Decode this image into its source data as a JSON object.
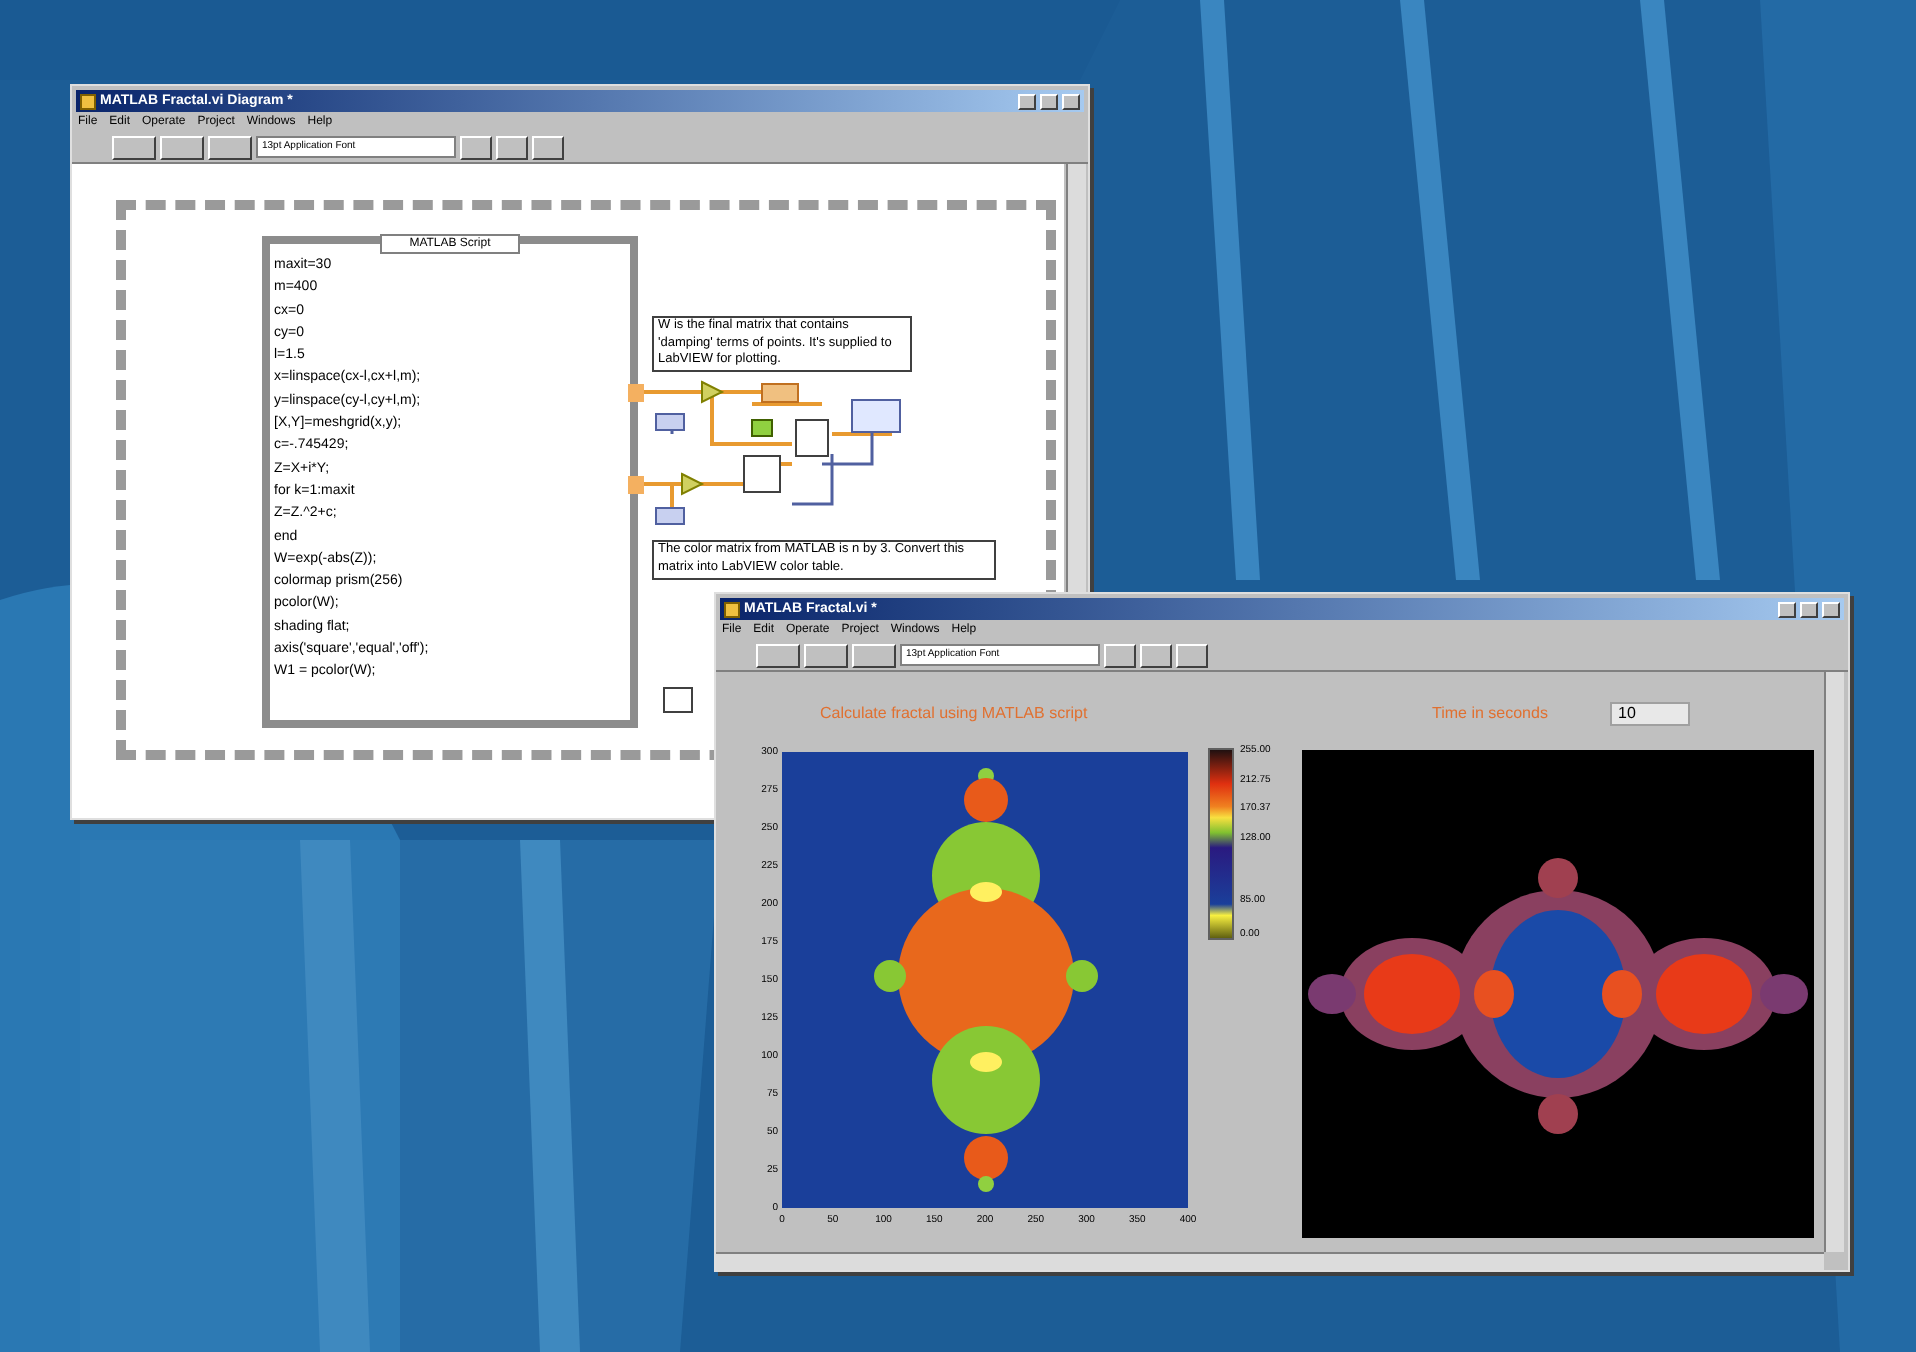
{
  "diagram_window": {
    "title": "MATLAB Fractal.vi Diagram *",
    "menu": [
      "File",
      "Edit",
      "Operate",
      "Project",
      "Windows",
      "Help"
    ],
    "font_selector": "13pt Application Font",
    "script_node": {
      "title": "MATLAB Script",
      "lines": [
        "maxit=30",
        "m=400",
        "cx=0",
        "cy=0",
        "l=1.5",
        "x=linspace(cx-l,cx+l,m);",
        "y=linspace(cy-l,cy+l,m);",
        "[X,Y]=meshgrid(x,y);",
        "c=-.745429;",
        "Z=X+i*Y;",
        "for k=1:maxit",
        "Z=Z.^2+c;",
        "end",
        "W=exp(-abs(Z));",
        "colormap prism(256)",
        "pcolor(W);",
        "shading flat;",
        "axis('square','equal','off');",
        "W1 = pcolor(W);"
      ]
    },
    "comments": [
      "W is the final matrix that contains 'damping' terms of points. It's supplied to LabVIEW for plotting.",
      "The color matrix from MATLAB is n by 3. Convert this matrix into LabVIEW color table."
    ]
  },
  "panel_window": {
    "title": "MATLAB Fractal.vi *",
    "menu": [
      "File",
      "Edit",
      "Operate",
      "Project",
      "Windows",
      "Help"
    ],
    "font_selector": "13pt Application Font",
    "heading": "Calculate fractal using MATLAB script",
    "time_label": "Time in seconds",
    "time_value": "10",
    "graph": {
      "yticks": [
        "300",
        "275",
        "250",
        "225",
        "200",
        "175",
        "150",
        "125",
        "100",
        "75",
        "50",
        "25",
        "0"
      ],
      "xticks": [
        "0",
        "50",
        "100",
        "150",
        "200",
        "250",
        "300",
        "350",
        "400"
      ]
    },
    "colorbar": {
      "labels": [
        "255.00",
        "212.75",
        "170.37",
        "128.00",
        "85.00",
        "0.00"
      ]
    }
  }
}
